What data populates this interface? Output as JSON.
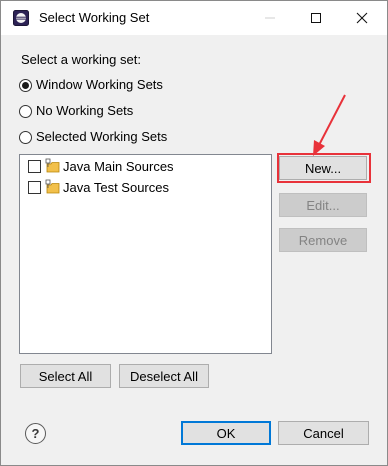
{
  "window": {
    "title": "Select Working Set",
    "controls": {
      "minimize": "minimize",
      "maximize": "maximize",
      "close": "close"
    }
  },
  "dialog": {
    "prompt": "Select a working set:",
    "radios": [
      {
        "label": "Window Working Sets",
        "checked": true
      },
      {
        "label": "No Working Sets",
        "checked": false
      },
      {
        "label": "Selected Working Sets",
        "checked": false
      }
    ],
    "working_sets": [
      {
        "label": "Java Main Sources",
        "checked": false
      },
      {
        "label": "Java Test Sources",
        "checked": false
      }
    ],
    "buttons": {
      "new": "New...",
      "edit": "Edit...",
      "remove": "Remove",
      "select_all": "Select All",
      "deselect_all": "Deselect All",
      "ok": "OK",
      "cancel": "Cancel"
    },
    "help_symbol": "?"
  },
  "annotation": {
    "color": "#e8323a"
  }
}
